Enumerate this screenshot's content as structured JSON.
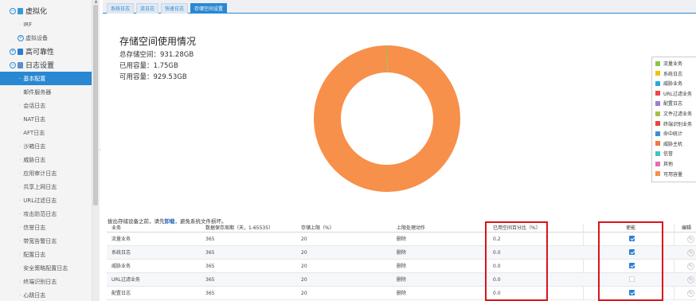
{
  "sidebar": {
    "items": [
      {
        "label": "虚拟化",
        "icon": "virtualization-icon"
      },
      {
        "label": "IRF"
      },
      {
        "label": "虚拟设备"
      },
      {
        "label": "高可靠性",
        "icon": "high-availability-icon"
      },
      {
        "label": "日志设置",
        "icon": "log-settings-icon"
      },
      {
        "label": "基本配置"
      },
      {
        "label": "邮件服务器"
      },
      {
        "label": "会话日志"
      },
      {
        "label": "NAT日志"
      },
      {
        "label": "AFT日志"
      },
      {
        "label": "沙箱日志"
      },
      {
        "label": "威胁日志"
      },
      {
        "label": "应用审计日志"
      },
      {
        "label": "共享上网日志"
      },
      {
        "label": "URL过滤日志"
      },
      {
        "label": "攻击防范日志"
      },
      {
        "label": "信誉日志"
      },
      {
        "label": "带宽告警日志"
      },
      {
        "label": "配置日志"
      },
      {
        "label": "安全策略配置日志"
      },
      {
        "label": "终端识别日志"
      },
      {
        "label": "心跳日志"
      }
    ]
  },
  "tabs": [
    "系统日志",
    "流日志",
    "快速日志",
    "存储空间设置"
  ],
  "main": {
    "title": "存储空间使用情况",
    "total_label": "总存储空间：931.28GB",
    "used_label": "已用容量：1.75GB",
    "free_label": "可用容量：929.53GB",
    "note_prefix": "拔出存储设备之前，请先",
    "note_link": "卸载",
    "note_suffix": "，避免系统文件损坏。"
  },
  "chart_data": {
    "type": "pie",
    "total": 931.28,
    "unit": "GB",
    "slices": [
      {
        "name": "流量业务",
        "value": 1.75,
        "color": "#8dc63f"
      },
      {
        "name": "可用容量",
        "value": 929.53,
        "color": "#f7904a"
      }
    ]
  },
  "legend": [
    {
      "name": "流量业务",
      "color": "#8dc63f"
    },
    {
      "name": "系统日志",
      "color": "#f5c200"
    },
    {
      "name": "威胁业务",
      "color": "#29a8e0"
    },
    {
      "name": "URL过滤业务",
      "color": "#e8474c"
    },
    {
      "name": "配置日志",
      "color": "#9b7fd4"
    },
    {
      "name": "文件过滤业务",
      "color": "#a3c14a"
    },
    {
      "name": "终端识别业务",
      "color": "#e7463e"
    },
    {
      "name": "命中统计",
      "color": "#3b8fd6"
    },
    {
      "name": "威胁主机",
      "color": "#f07a3b"
    },
    {
      "name": "信誉",
      "color": "#3ec7c0"
    },
    {
      "name": "其他",
      "color": "#e86ab0"
    },
    {
      "name": "可用容量",
      "color": "#f7904a"
    }
  ],
  "table": {
    "headers": [
      "业务",
      "数据保存周期（天，1-65535）",
      "存储上限（%）",
      "上限处理动作",
      "已用空间百分比（%）",
      "使能",
      "编辑"
    ],
    "rows": [
      {
        "service": "流量业务",
        "period": "365",
        "limit": "20",
        "action": "删除",
        "used": "0.2",
        "enabled": true
      },
      {
        "service": "系统日志",
        "period": "365",
        "limit": "20",
        "action": "删除",
        "used": "0.0",
        "enabled": true
      },
      {
        "service": "威胁业务",
        "period": "365",
        "limit": "20",
        "action": "删除",
        "used": "0.0",
        "enabled": true
      },
      {
        "service": "URL过滤业务",
        "period": "365",
        "limit": "20",
        "action": "删除",
        "used": "0.0",
        "enabled": false
      },
      {
        "service": "配置日志",
        "period": "365",
        "limit": "20",
        "action": "删除",
        "used": "0.0",
        "enabled": true
      }
    ]
  }
}
